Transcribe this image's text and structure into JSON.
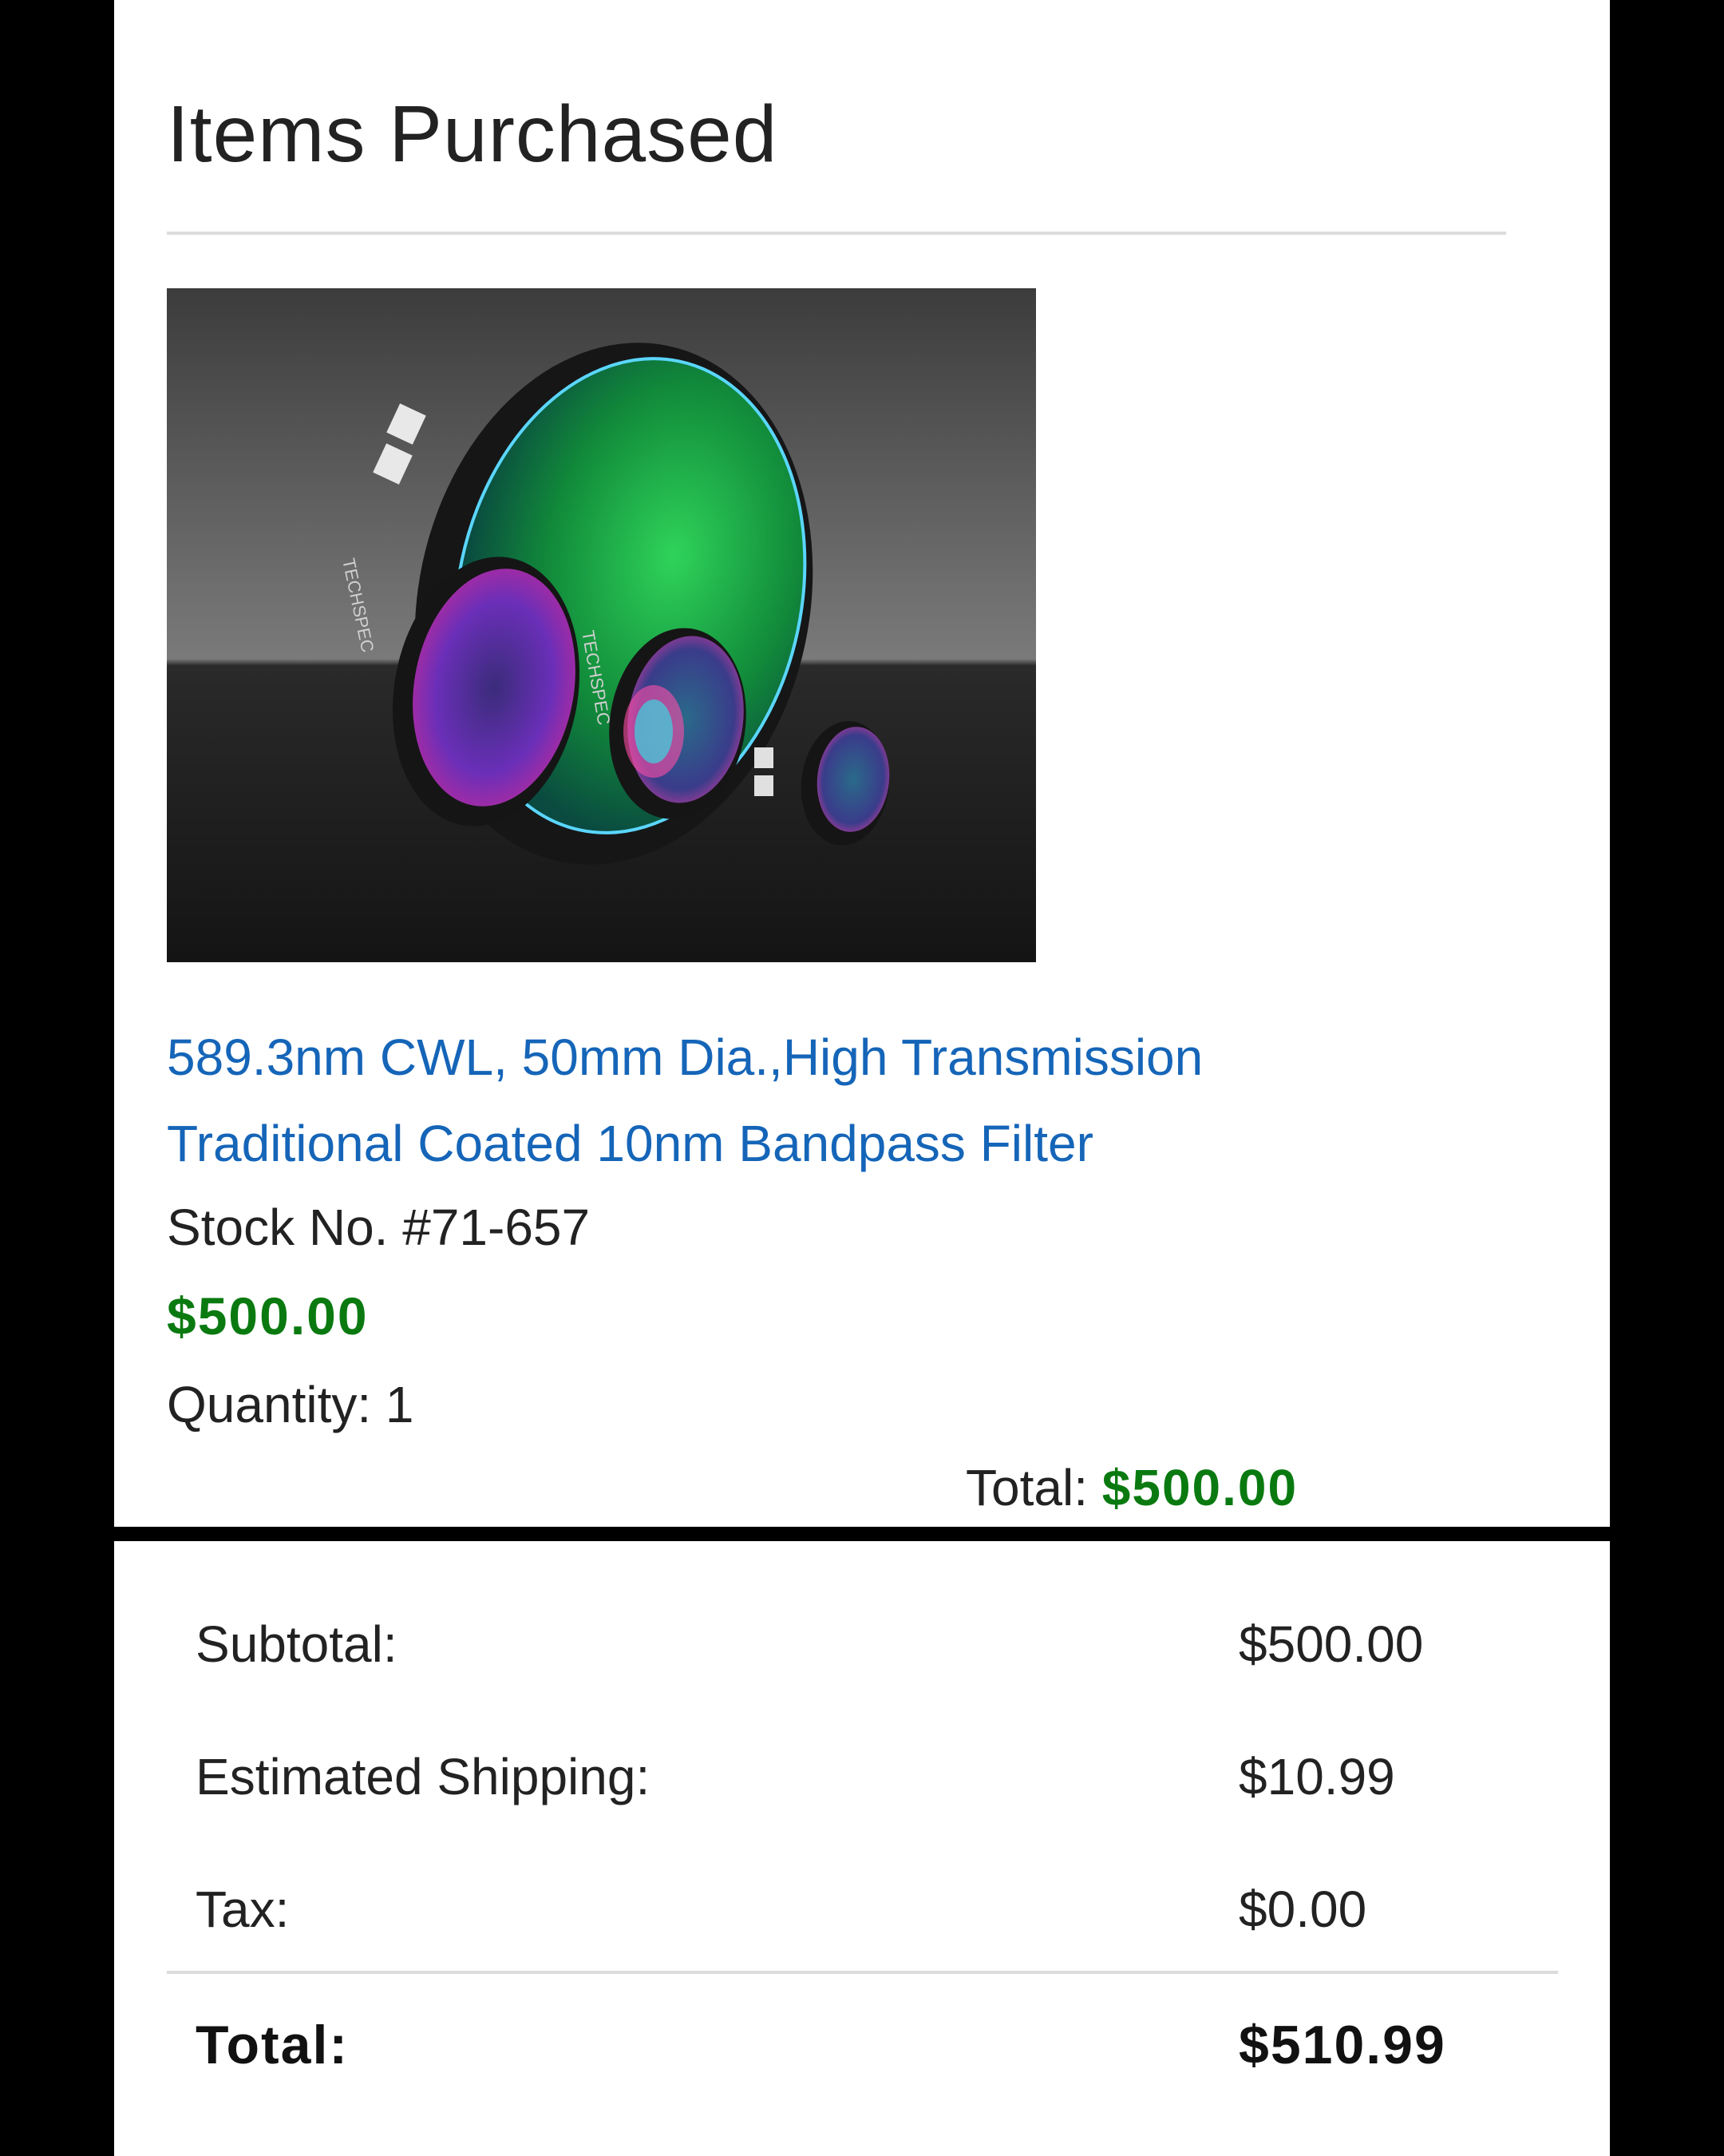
{
  "items_purchased": {
    "title": "Items Purchased",
    "item": {
      "image_alt": "Bandpass filters product photo",
      "name": "589.3nm CWL, 50mm Dia.,High Transmission Traditional Coated 10nm Bandpass Filter",
      "stock_number": "Stock No. #71-657",
      "price": "$500.00",
      "quantity": "Quantity: 1",
      "total_label": "Total: ",
      "total_value": "$500.00",
      "engraving": "TECHSPEC"
    }
  },
  "order_summary": {
    "subtotal_label": "Subtotal:",
    "subtotal_value": "$500.00",
    "shipping_label": "Estimated Shipping:",
    "shipping_value": "$10.99",
    "tax_label": "Tax:",
    "tax_value": "$0.00",
    "total_label": "Total:",
    "total_value": "$510.99"
  },
  "colors": {
    "link": "#1565b8",
    "price_green": "#0a7a10",
    "text": "#222222",
    "divider": "#dcdcdc",
    "frame": "#000000"
  }
}
